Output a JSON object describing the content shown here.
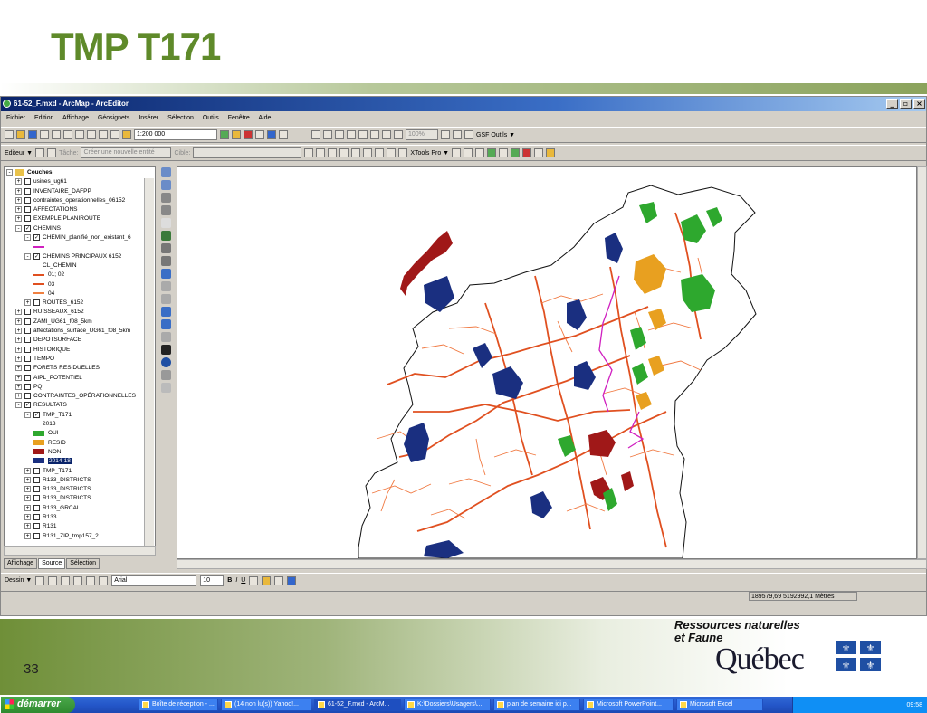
{
  "slide": {
    "title": "TMP T171",
    "number": "33"
  },
  "logo": {
    "line1": "Ressources naturelles",
    "line2": "et Faune",
    "quebec": "Québec"
  },
  "window": {
    "title": "61-52_F.mxd - ArcMap - ArcEditor",
    "min": "_",
    "max": "▫",
    "close": "×"
  },
  "menu": [
    "Fichier",
    "Edition",
    "Affichage",
    "Géosignets",
    "Insérer",
    "Sélection",
    "Outils",
    "Fenêtre",
    "Aide"
  ],
  "toolbar1": {
    "scale": "1:200 000",
    "zoom": "100%",
    "gsf": "GSF Outils ▼"
  },
  "toolbar2": {
    "editor": "Editeur ▼",
    "task_label": "Tâche:",
    "task_value": "Créer une nouvelle entité",
    "target_label": "Cible:",
    "xtools": "XTools Pro ▼"
  },
  "toc": {
    "rows": [
      {
        "text": "Couches",
        "depth": 0,
        "exp": "-",
        "cb": false,
        "icon": "folder",
        "bold": true
      },
      {
        "text": "usines_ug61",
        "depth": 1,
        "exp": "+",
        "cb": true,
        "checked": false
      },
      {
        "text": "INVENTAIRE_DAFPP",
        "depth": 1,
        "exp": "+",
        "cb": true,
        "checked": false
      },
      {
        "text": "contraintes_operationnelles_06152",
        "depth": 1,
        "exp": "+",
        "cb": true,
        "checked": false
      },
      {
        "text": "AFFECTATIONS",
        "depth": 1,
        "exp": "+",
        "cb": true,
        "checked": false
      },
      {
        "text": "EXEMPLE PLANIROUTE",
        "depth": 1,
        "exp": "+",
        "cb": true,
        "checked": false
      },
      {
        "text": "CHEMINS",
        "depth": 1,
        "exp": "-",
        "cb": true,
        "checked": true
      },
      {
        "text": "CHEMIN_planifié_non_existant_6",
        "depth": 2,
        "exp": "-",
        "cb": true,
        "checked": true
      },
      {
        "text": "",
        "depth": 3,
        "line": "#d020c0"
      },
      {
        "text": "CHEMINS PRINCIPAUX 6152",
        "depth": 2,
        "exp": "-",
        "cb": true,
        "checked": true
      },
      {
        "text": "CL_CHEMIN",
        "depth": 4
      },
      {
        "text": "01; 02",
        "depth": 3,
        "line": "#e05020"
      },
      {
        "text": "03",
        "depth": 3,
        "line": "#e05020"
      },
      {
        "text": "04",
        "depth": 3,
        "line": "#f08040"
      },
      {
        "text": "ROUTES_6152",
        "depth": 2,
        "exp": "+",
        "cb": true,
        "checked": false
      },
      {
        "text": "RUISSEAUX_6152",
        "depth": 1,
        "exp": "+",
        "cb": true,
        "checked": false
      },
      {
        "text": "ZAMI_UG61_f08_5km",
        "depth": 1,
        "exp": "+",
        "cb": true,
        "checked": false
      },
      {
        "text": "affectations_surface_UG61_f08_5km",
        "depth": 1,
        "exp": "+",
        "cb": true,
        "checked": false
      },
      {
        "text": "DEPOTSURFACE",
        "depth": 1,
        "exp": "+",
        "cb": true,
        "checked": false
      },
      {
        "text": "HISTORIQUE",
        "depth": 1,
        "exp": "+",
        "cb": true,
        "checked": false
      },
      {
        "text": "TEMPO",
        "depth": 1,
        "exp": "+",
        "cb": true,
        "checked": false
      },
      {
        "text": "FORETS RESIDUELLES",
        "depth": 1,
        "exp": "+",
        "cb": true,
        "checked": false
      },
      {
        "text": "AIPL_POTENTIEL",
        "depth": 1,
        "exp": "+",
        "cb": true,
        "checked": false
      },
      {
        "text": "PQ",
        "depth": 1,
        "exp": "+",
        "cb": true,
        "checked": false
      },
      {
        "text": "CONTRAINTES_OPÉRATIONNELLES",
        "depth": 1,
        "exp": "+",
        "cb": true,
        "checked": false
      },
      {
        "text": "RESULTATS",
        "depth": 1,
        "exp": "-",
        "cb": true,
        "checked": true
      },
      {
        "text": "TMP_T171",
        "depth": 2,
        "exp": "-",
        "cb": true,
        "checked": true
      },
      {
        "text": "2013",
        "depth": 4
      },
      {
        "text": "OUI",
        "depth": 3,
        "swatch": "#2ea82e"
      },
      {
        "text": "RESID",
        "depth": 3,
        "swatch": "#e8a020"
      },
      {
        "text": "NON",
        "depth": 3,
        "swatch": "#a01818"
      },
      {
        "text": "2014-18",
        "depth": 3,
        "swatch": "#1a2f80",
        "selected": true
      },
      {
        "text": "TMP_T171",
        "depth": 2,
        "exp": "+",
        "cb": true,
        "checked": false
      },
      {
        "text": "R133_DISTRICTS",
        "depth": 2,
        "exp": "+",
        "cb": true,
        "checked": false
      },
      {
        "text": "R133_DISTRICTS",
        "depth": 2,
        "exp": "+",
        "cb": true,
        "checked": false
      },
      {
        "text": "R133_DISTRICTS",
        "depth": 2,
        "exp": "+",
        "cb": true,
        "checked": false
      },
      {
        "text": "R133_GRCAL",
        "depth": 2,
        "exp": "+",
        "cb": true,
        "checked": false
      },
      {
        "text": "R133",
        "depth": 2,
        "exp": "+",
        "cb": true,
        "checked": false
      },
      {
        "text": "R131",
        "depth": 2,
        "exp": "+",
        "cb": true,
        "checked": false
      },
      {
        "text": "R131_ZIP_tmp157_2",
        "depth": 2,
        "exp": "+",
        "cb": true,
        "checked": false
      }
    ],
    "tabs": [
      "Affichage",
      "Source",
      "Sélection"
    ]
  },
  "drawbar": {
    "draw": "Dessin ▼",
    "font": "Arial",
    "size": "10",
    "bold": "B",
    "italic": "I",
    "underline": "U"
  },
  "status": {
    "coords": "189579,69  5192992,1 Mètres"
  },
  "taskbar": {
    "start": "démarrer",
    "items": [
      "Boîte de réception - ...",
      "(14 non lu(s)) Yahoo!...",
      "61-52_F.mxd - ArcM...",
      "K:\\Dossiers\\Usagers\\...",
      "plan de semaine ici p...",
      "Microsoft PowerPoint...",
      "Microsoft Excel"
    ],
    "clock": "09:58"
  },
  "colors": {
    "oui": "#2ea82e",
    "resid": "#e8a020",
    "non": "#a01818",
    "y2014": "#1a2f80",
    "roads": "#e05020",
    "planned": "#d020c0"
  }
}
